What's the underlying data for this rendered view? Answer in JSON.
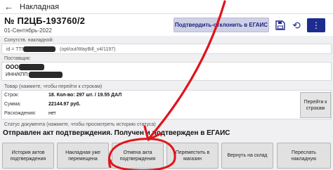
{
  "appbar": {
    "title": "Накладная",
    "back_icon": "back-arrow-icon"
  },
  "header": {
    "doc_number": "№ П2ЦБ-193760/2",
    "date": "01-Сентябрь-2022",
    "confirm_button": "Подтвердить-отклонить в ЕГАИС",
    "icons": [
      "save-icon",
      "refresh-icon",
      "more-icon"
    ]
  },
  "accompanying": {
    "label": "Сопутств. накладной:",
    "id_prefix": "id = TTN-",
    "id_suffix": "(opt/out/WayBill_v4/1197)"
  },
  "supplier": {
    "label": "Поставщик:",
    "name": "ООО",
    "inn": "ИНН/КПП:"
  },
  "goods": {
    "label": "Товар (нажмите, чтобы перейти к строкам)",
    "rows": [
      {
        "key": "Строк:",
        "value": "18. Кол-во: 297 шт. / 19.55 ДАЛ"
      },
      {
        "key": "Сумма:",
        "value": "22144.97 руб."
      },
      {
        "key": "Расхождения:",
        "value": "нет"
      }
    ],
    "goto_button": "Перейти к строкам"
  },
  "status": {
    "label": "Статус документа (нажмите, чтобы просмотреть историю статуса)",
    "text": "Отправлен акт подтверждения. Получен и подтвержден в ЕГАИС"
  },
  "actions": [
    {
      "label": "История актов подтверждения"
    },
    {
      "label": "Накладная уже перемещена"
    },
    {
      "label": "Отмена акта подтверждения"
    },
    {
      "label": "Переместить в магазин"
    },
    {
      "label": "Вернуть на склад"
    },
    {
      "label": "Переслать накладную"
    }
  ],
  "colors": {
    "primary": "#1d2c8f",
    "confirm_bg": "#cfd1e6",
    "annotation": "#e0141b"
  }
}
